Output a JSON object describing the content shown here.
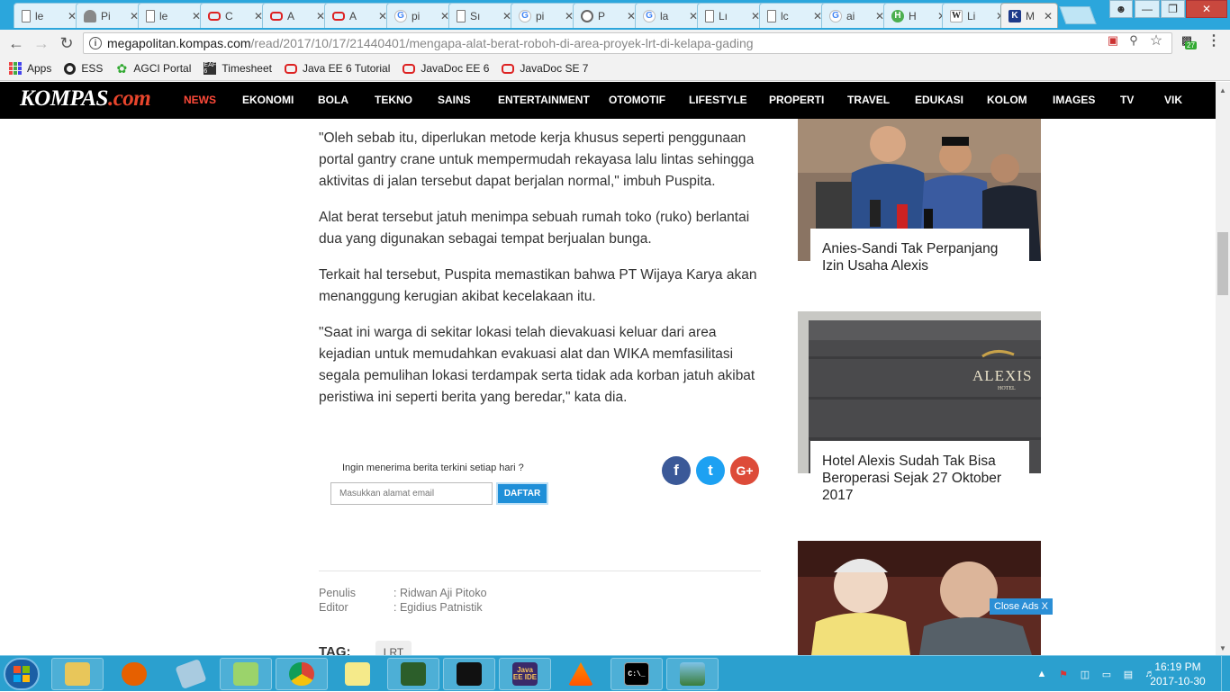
{
  "browser": {
    "tabs": [
      {
        "title": "le",
        "icon": "document-icon"
      },
      {
        "title": "Pi",
        "icon": "shield-icon"
      },
      {
        "title": "le",
        "icon": "document-icon"
      },
      {
        "title": "C",
        "icon": "oracle-icon"
      },
      {
        "title": "A",
        "icon": "oracle-icon"
      },
      {
        "title": "A",
        "icon": "oracle-icon"
      },
      {
        "title": "pi",
        "icon": "google-icon"
      },
      {
        "title": "Sı",
        "icon": "document-icon"
      },
      {
        "title": "pi",
        "icon": "google-icon"
      },
      {
        "title": "P",
        "icon": "clock-icon"
      },
      {
        "title": "la",
        "icon": "google-icon"
      },
      {
        "title": "Lı",
        "icon": "document-icon"
      },
      {
        "title": "lc",
        "icon": "document-icon"
      },
      {
        "title": "ai",
        "icon": "google-icon"
      },
      {
        "title": "H",
        "icon": "green-h-icon"
      },
      {
        "title": "Li",
        "icon": "wikipedia-icon"
      },
      {
        "title": "M",
        "icon": "kompas-icon"
      }
    ],
    "tab_glyphs": {
      "google": "G",
      "green": "H",
      "wiki": "W",
      "kompas": "K",
      "close": "✕"
    },
    "active_tab_index": 16,
    "url_host": "megapolitan.kompas.com",
    "url_path": "/read/2017/10/17/21440401/mengapa-alat-berat-roboh-di-area-proyek-lrt-di-kelapa-gading",
    "extension_badge": "27",
    "bookmarks": [
      {
        "label": "Apps",
        "icon": "apps-grid-icon"
      },
      {
        "label": "ESS",
        "icon": "ess-icon"
      },
      {
        "label": "AGCI Portal",
        "icon": "agci-icon"
      },
      {
        "label": "Timesheet",
        "icon": "timesheet-icon"
      },
      {
        "label": "Java EE 6 Tutorial",
        "icon": "oracle-icon"
      },
      {
        "label": "JavaDoc EE 6",
        "icon": "oracle-icon"
      },
      {
        "label": "JavaDoc SE 7",
        "icon": "oracle-icon"
      }
    ],
    "bookmark_glyphs": {
      "agci": "✿",
      "timesheet": "EAF 6"
    }
  },
  "site": {
    "logo_main": "KOMPAS",
    "logo_dot": ".com",
    "nav": [
      {
        "label": "NEWS",
        "active": true
      },
      {
        "label": "EKONOMI"
      },
      {
        "label": "BOLA"
      },
      {
        "label": "TEKNO"
      },
      {
        "label": "SAINS"
      },
      {
        "label": "ENTERTAINMENT"
      },
      {
        "label": "OTOMOTIF"
      },
      {
        "label": "LIFESTYLE"
      },
      {
        "label": "PROPERTI"
      },
      {
        "label": "TRAVEL"
      },
      {
        "label": "EDUKASI"
      },
      {
        "label": "KOLOM"
      },
      {
        "label": "IMAGES"
      },
      {
        "label": "TV"
      },
      {
        "label": "VIK"
      }
    ]
  },
  "article": {
    "paragraphs": [
      "\"Oleh sebab itu, diperlukan metode kerja khusus seperti penggunaan portal gantry crane untuk mempermudah rekayasa lalu lintas sehingga aktivitas di jalan tersebut dapat berjalan normal,\" imbuh Puspita.",
      "Alat berat tersebut jatuh menimpa sebuah rumah toko (ruko) berlantai dua yang digunakan sebagai tempat berjualan bunga.",
      "Terkait hal tersebut, Puspita memastikan bahwa PT Wijaya Karya akan menanggung kerugian akibat kecelakaan itu.",
      "\"Saat ini warga di sekitar lokasi telah dievakuasi keluar dari area kejadian untuk memudahkan evakuasi alat dan WIKA memfasilitasi segala pemulihan lokasi terdampak serta tidak ada korban jatuh akibat peristiwa ini seperti berita yang beredar,\" kata dia."
    ],
    "newsletter_prompt": "Ingin menerima berita terkini setiap hari ?",
    "email_placeholder": "Masukkan alamat email",
    "subscribe_label": "DAFTAR",
    "social_glyphs": {
      "facebook": "f",
      "twitter": "t",
      "google_plus": "G+"
    },
    "author_label": "Penulis",
    "author_value": ": Ridwan Aji Pitoko",
    "editor_label": "Editor",
    "editor_value": ": Egidius Patnistik",
    "tag_label": "TAG:",
    "tags": [
      "LRT"
    ]
  },
  "sidebar": {
    "cards": [
      {
        "caption": "Anies-Sandi Tak Perpanjang Izin Usaha Alexis"
      },
      {
        "caption": "Hotel Alexis Sudah Tak Bisa Beroperasi Sejak 27 Oktober 2017",
        "sign_text": "ALEXIS",
        "sign_sub": "HOTEL"
      },
      {
        "caption": ""
      }
    ],
    "close_ads_label": "Close Ads X"
  },
  "taskbar": {
    "apps": [
      "explorer",
      "firefox",
      "notepad",
      "notepad-plus",
      "chrome",
      "sticky-notes",
      "remote-desktop",
      "inkscape",
      "java-ee-ide",
      "vlc",
      "command-prompt",
      "image-viewer"
    ],
    "java_ide_label": "Java EE IDE",
    "cmd_label": "C:\\_",
    "time": "16:19 PM",
    "date": "2017-10-30"
  },
  "colors": {
    "tab_bar": "#2ba6dc",
    "kompas_nav": "#000000",
    "nav_active": "#ff4a3a",
    "subscribe_button": "#1f8fd8",
    "facebook": "#3b5998",
    "twitter": "#1da1f2",
    "google_plus": "#dd4b39",
    "taskbar": "#2ba0cf"
  }
}
